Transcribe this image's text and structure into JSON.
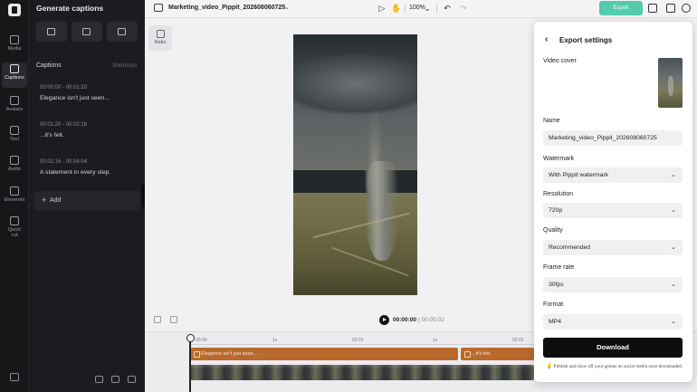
{
  "rail": {
    "items": [
      {
        "label": "Media",
        "icon": "media-icon"
      },
      {
        "label": "Captions",
        "icon": "captions-icon"
      },
      {
        "label": "Avatars",
        "icon": "avatar-icon"
      },
      {
        "label": "Text",
        "icon": "text-icon"
      },
      {
        "label": "Audio",
        "icon": "audio-icon"
      },
      {
        "label": "Elements",
        "icon": "elements-icon"
      },
      {
        "label": "Quick",
        "icon": "quick-cut-icon"
      },
      {
        "label": "cut",
        "icon": ""
      }
    ]
  },
  "panel": {
    "title": "Generate captions",
    "captions_heading": "Captions",
    "shortcuts": "Shortcuts",
    "captions": [
      {
        "time": "00:00:00  -  00:01:20",
        "text": "Elegance isn't just seen..."
      },
      {
        "time": "00:01:20  -  00:02:16",
        "text": "...it's felt."
      },
      {
        "time": "00:02:16  -  00:04:04",
        "text": "A statement in every step."
      }
    ],
    "add_label": "Add"
  },
  "topbar": {
    "project_name": "Marketing_video_Pippit_202608060725",
    "zoom": "100%",
    "export_label": "Export"
  },
  "canvas": {
    "ratio_label": "Ratio"
  },
  "player": {
    "current_time": "00:00:00",
    "separator": "|",
    "total_time": "00:05:02"
  },
  "timeline": {
    "ticks": [
      "00:00",
      "1s",
      "00:01",
      "1s",
      "00:02"
    ],
    "clips": [
      {
        "label": "Elegance isn't just seen..."
      },
      {
        "label": "...it's felt."
      }
    ]
  },
  "export_dialog": {
    "title": "Export settings",
    "video_cover_label": "Video cover",
    "name_label": "Name",
    "name_value": "Marketing_video_Pippit_202608060725",
    "watermark_label": "Watermark",
    "watermark_value": "With Pippit watermark",
    "resolution_label": "Resolution",
    "resolution_value": "720p",
    "quality_label": "Quality",
    "quality_value": "Recommended",
    "frame_rate_label": "Frame rate",
    "frame_rate_value": "30fps",
    "format_label": "Format",
    "format_value": "MP4",
    "download_label": "Download",
    "promo_text": "Publish and show off your genius on social media once downloaded."
  },
  "colors": {
    "accent": "#2ec29d",
    "clip": "#b86a2c",
    "panel_bg": "#1c1c20"
  }
}
